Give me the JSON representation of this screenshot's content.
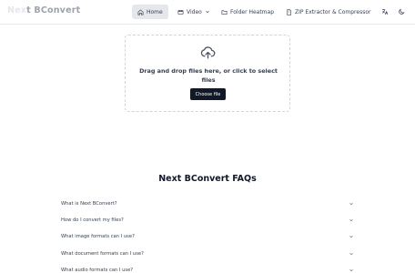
{
  "header": {
    "brand": "Next BConvert",
    "brand_prefix": "Nex",
    "brand_mid": "t ",
    "brand_rest": "BConvert",
    "nav": [
      {
        "label": "Home",
        "icon": "home-icon",
        "active": true
      },
      {
        "label": "Video",
        "icon": "video-icon",
        "active": false,
        "has_dropdown": true
      },
      {
        "label": "Folder Heatmap",
        "icon": "folder-icon",
        "active": false
      },
      {
        "label": "ZIP Extractor & Compressor",
        "icon": "file-archive-icon",
        "active": false
      }
    ],
    "actions": [
      "translate-icon",
      "moon-icon"
    ]
  },
  "upload": {
    "prompt": "Drag and drop files here, or click to select files",
    "button_label": "Choose file"
  },
  "faq": {
    "title": "Next BConvert FAQs",
    "items": [
      {
        "question": "What is Next BConvert?"
      },
      {
        "question": "How do I convert my files?"
      },
      {
        "question": "What image formats can I use?"
      },
      {
        "question": "What document formats can I use?"
      },
      {
        "question": "What audio formats can I use?"
      }
    ]
  },
  "colors": {
    "accent_dark": "#111827",
    "border": "#e5e7eb",
    "active_nav_bg": "#e5e7eb"
  }
}
